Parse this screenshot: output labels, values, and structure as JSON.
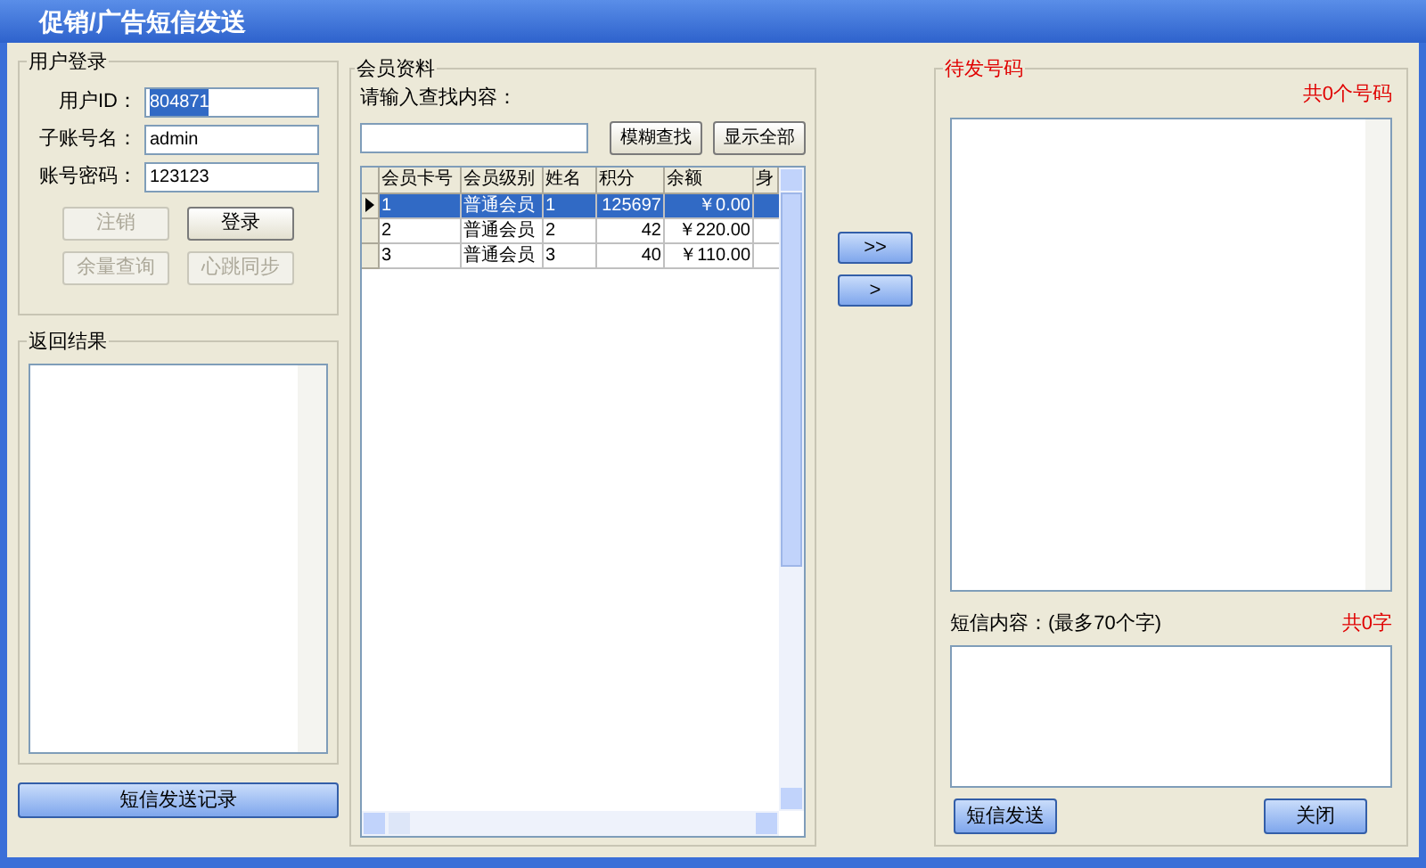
{
  "window": {
    "title": "促销/广告短信发送"
  },
  "login": {
    "title": "用户登录",
    "fields": [
      {
        "label": "用户ID：",
        "value": "804871",
        "selected": true
      },
      {
        "label": "子账号名：",
        "value": "admin",
        "selected": false
      },
      {
        "label": "账号密码：",
        "value": "123123",
        "selected": false
      }
    ],
    "buttons": [
      {
        "label": "注销",
        "disabled": true
      },
      {
        "label": "登录",
        "disabled": false
      },
      {
        "label": "余量查询",
        "disabled": true
      },
      {
        "label": "心跳同步",
        "disabled": true
      }
    ]
  },
  "result": {
    "title": "返回结果"
  },
  "history_button": "短信发送记录",
  "members": {
    "title": "会员资料",
    "search_label": "请输入查找内容：",
    "buttons": [
      "模糊查找",
      "显示全部"
    ],
    "columns": [
      "会员卡号",
      "会员级别",
      "姓名",
      "积分",
      "余额",
      "身"
    ],
    "rows": [
      {
        "cells": [
          "1",
          "普通会员",
          "1",
          "125697",
          "￥0.00"
        ],
        "selected": true
      },
      {
        "cells": [
          "2",
          "普通会员",
          "2",
          "42",
          "￥220.00"
        ],
        "selected": false
      },
      {
        "cells": [
          "3",
          "普通会员",
          "3",
          "40",
          "￥110.00"
        ],
        "selected": false
      }
    ]
  },
  "move_buttons": [
    ">>",
    ">"
  ],
  "pending": {
    "title": "待发号码",
    "count": "共0个号码"
  },
  "message": {
    "label": "短信内容：(最多70个字)",
    "count": "共0字"
  },
  "send_button": "短信发送",
  "close_button": "关闭"
}
